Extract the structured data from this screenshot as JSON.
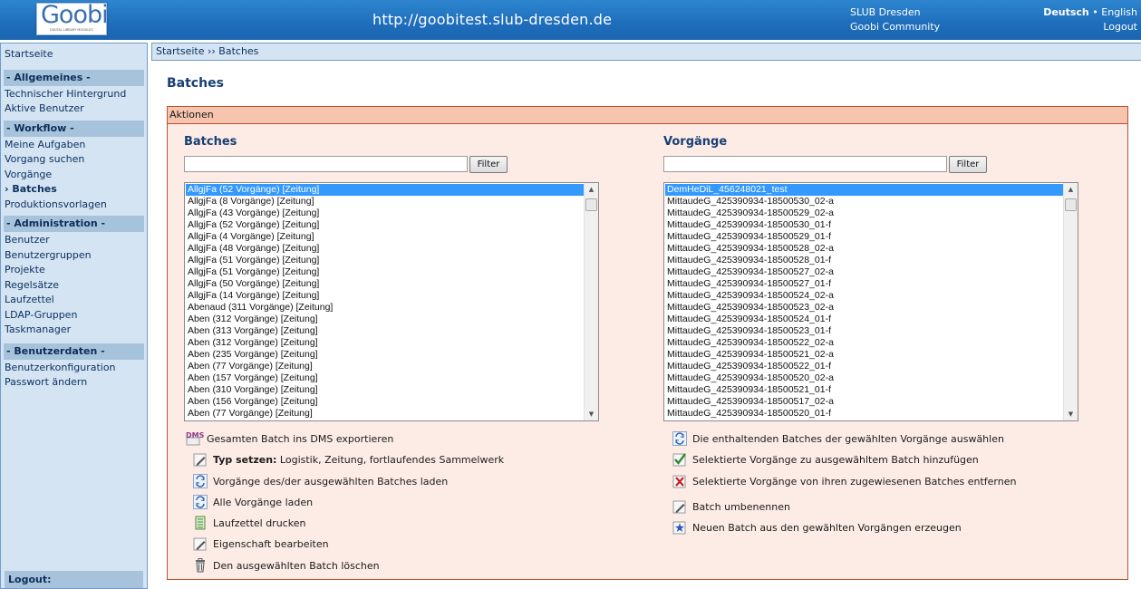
{
  "header": {
    "logo_text": "Goobi",
    "logo_subtitle": "DIGITAL LIBRARY MODULES",
    "url": "http://goobitest.slub-dresden.de",
    "links": [
      "SLUB Dresden",
      "Goobi Community"
    ],
    "lang_active": "Deutsch",
    "lang_separator": " • ",
    "lang_other": "English",
    "logout": "Logout"
  },
  "sidebar": {
    "start": "Startseite",
    "sections": [
      {
        "title": "- Allgemeines -",
        "items": [
          "Technischer Hintergrund",
          "Aktive Benutzer"
        ]
      },
      {
        "title": "- Workflow -",
        "items": [
          "Meine Aufgaben",
          "Vorgang suchen",
          "Vorgänge",
          "› Batches",
          "Produktionsvorlagen"
        ]
      },
      {
        "title": "- Administration -",
        "items": [
          "Benutzer",
          "Benutzergruppen",
          "Projekte",
          "Regelsätze",
          "Laufzettel",
          "LDAP-Gruppen",
          "Taskmanager"
        ]
      },
      {
        "title": "- Benutzerdaten -",
        "items": [
          "Benutzerkonfiguration",
          "Passwort ändern"
        ]
      }
    ],
    "logout": "Logout:"
  },
  "breadcrumb": "Startseite ›› Batches",
  "page_title": "Batches",
  "panel_title": "Aktionen",
  "left": {
    "title": "Batches",
    "filter_value": "",
    "filter_button": "Filter",
    "items": [
      "AllgjFa (52 Vorgänge) [Zeitung]",
      "AllgjFa (8 Vorgänge) [Zeitung]",
      "AllgjFa (43 Vorgänge) [Zeitung]",
      "AllgjFa (52 Vorgänge) [Zeitung]",
      "AllgjFa (4 Vorgänge) [Zeitung]",
      "AllgjFa (48 Vorgänge) [Zeitung]",
      "AllgjFa (51 Vorgänge) [Zeitung]",
      "AllgjFa (51 Vorgänge) [Zeitung]",
      "AllgjFa (50 Vorgänge) [Zeitung]",
      "AllgjFa (14 Vorgänge) [Zeitung]",
      "Abenaud (311 Vorgänge) [Zeitung]",
      "Aben (312 Vorgänge) [Zeitung]",
      "Aben (313 Vorgänge) [Zeitung]",
      "Aben (312 Vorgänge) [Zeitung]",
      "Aben (235 Vorgänge) [Zeitung]",
      "Aben (77 Vorgänge) [Zeitung]",
      "Aben (157 Vorgänge) [Zeitung]",
      "Aben (310 Vorgänge) [Zeitung]",
      "Aben (156 Vorgänge) [Zeitung]",
      "Aben (77 Vorgänge) [Zeitung]"
    ],
    "actions": [
      {
        "icon": "dms-export-icon",
        "label": "Gesamten Batch ins DMS exportieren"
      },
      {
        "icon": "pencil-icon",
        "label_bold": "Typ setzen:",
        "label": " Logistik, Zeitung, fortlaufendes Sammelwerk"
      },
      {
        "icon": "refresh-icon",
        "label": "Vorgänge des/der ausgewählten Batches laden"
      },
      {
        "icon": "refresh-icon",
        "label": "Alle Vorgänge laden"
      },
      {
        "icon": "document-icon",
        "label": "Laufzettel drucken"
      },
      {
        "icon": "pencil-icon",
        "label": "Eigenschaft bearbeiten"
      },
      {
        "icon": "trash-icon",
        "label": "Den ausgewählten Batch löschen"
      }
    ]
  },
  "right": {
    "title": "Vorgänge",
    "filter_value": "",
    "filter_button": "Filter",
    "items": [
      "DemHeDiL_456248021_test",
      "MittaudeG_425390934-18500530_02-a",
      "MittaudeG_425390934-18500529_02-a",
      "MittaudeG_425390934-18500530_01-f",
      "MittaudeG_425390934-18500529_01-f",
      "MittaudeG_425390934-18500528_02-a",
      "MittaudeG_425390934-18500528_01-f",
      "MittaudeG_425390934-18500527_02-a",
      "MittaudeG_425390934-18500527_01-f",
      "MittaudeG_425390934-18500524_02-a",
      "MittaudeG_425390934-18500523_02-a",
      "MittaudeG_425390934-18500524_01-f",
      "MittaudeG_425390934-18500523_01-f",
      "MittaudeG_425390934-18500522_02-a",
      "MittaudeG_425390934-18500521_02-a",
      "MittaudeG_425390934-18500522_01-f",
      "MittaudeG_425390934-18500520_02-a",
      "MittaudeG_425390934-18500521_01-f",
      "MittaudeG_425390934-18500517_02-a",
      "MittaudeG_425390934-18500520_01-f"
    ],
    "actions": [
      {
        "icon": "refresh-icon",
        "label": "Die enthaltenden Batches der gewählten Vorgänge auswählen"
      },
      {
        "icon": "check-icon",
        "label": "Selektierte Vorgänge zu ausgewähltem Batch hinzufügen"
      },
      {
        "icon": "remove-icon",
        "label": "Selektierte Vorgänge von ihren zugewiesenen Batches entfernen"
      },
      {
        "icon": "pencil-icon",
        "label": "Batch umbenennen"
      },
      {
        "icon": "new-batch-icon",
        "label": "Neuen Batch aus den gewählten Vorgängen erzeugen"
      }
    ]
  },
  "colors": {
    "header": "#1f6fbd",
    "sidebar": "#d4e4f3",
    "panel": "#fdece6",
    "panel_border": "#b5542f",
    "selection": "#3399ff"
  }
}
